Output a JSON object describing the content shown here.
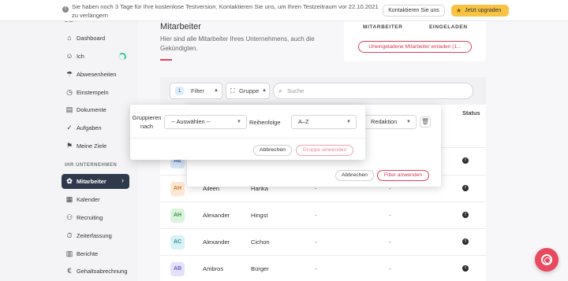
{
  "banner": {
    "text": "Sie haben noch 3 Tage für Ihre kostenlose Testversion. Kontaktieren Sie uns, um Ihren Testzeitraum vor 22.10.2021 zu verlängern",
    "contact_label": "Kontaktieren Sie uns",
    "upgrade_label": "Jetzt upgraden",
    "upgrade_color": "#f6c343"
  },
  "sidebar": {
    "section_top": "SIE",
    "section_company": "IHR UNTERNEHMEN",
    "items_top": [
      {
        "label": "Dashboard",
        "icon": "dashboard-icon"
      },
      {
        "label": "Ich",
        "icon": "user-icon"
      },
      {
        "label": "Abwesenheiten",
        "icon": "absence-icon"
      },
      {
        "label": "Einstempeln",
        "icon": "clock-icon"
      },
      {
        "label": "Dokumente",
        "icon": "document-icon"
      },
      {
        "label": "Aufgaben",
        "icon": "tasks-icon"
      },
      {
        "label": "Meine Ziele",
        "icon": "goals-icon"
      }
    ],
    "items_company": [
      {
        "label": "Mitarbeiter",
        "icon": "employees-icon",
        "active": true
      },
      {
        "label": "Kalender",
        "icon": "calendar-icon"
      },
      {
        "label": "Recruiting",
        "icon": "recruiting-icon"
      },
      {
        "label": "Zeiterfassung",
        "icon": "time-tracking-icon"
      },
      {
        "label": "Berichte",
        "icon": "reports-icon"
      },
      {
        "label": "Gehaltsabrechnung",
        "icon": "payroll-icon"
      }
    ],
    "active_color": "#2e3a4b"
  },
  "main": {
    "title": "Mitarbeiter",
    "subtitle": "Hier sind alle Mitarbeiter Ihres Unternehmens, auch die Gekündigten.",
    "stats": {
      "label_employees": "MITARBEITER",
      "label_invited": "EINGELADEN"
    },
    "invite_button": "Uneingeladene Mitarbeiter einladen (1...",
    "accent_color": "#e0425a"
  },
  "toolbar": {
    "filter_count": "1",
    "filter_label": "Filter",
    "group_label": "Gruppe",
    "search_placeholder": "Suche"
  },
  "table": {
    "status_header": "Status",
    "rows": [
      {
        "initials": "AE",
        "first": "",
        "last": "",
        "c1": "",
        "c2": "",
        "bg": "#dbe8fb",
        "fg": "#4a74b8"
      },
      {
        "initials": "AH",
        "first": "Aileen",
        "last": "Hanka",
        "c1": "-",
        "c2": "-",
        "bg": "#fde7d4",
        "fg": "#d07a2c"
      },
      {
        "initials": "AH",
        "first": "Alexander",
        "last": "Hingst",
        "c1": "-",
        "c2": "-",
        "bg": "#dbf3dc",
        "fg": "#3b9a45"
      },
      {
        "initials": "AC",
        "first": "Alexander",
        "last": "Cichon",
        "c1": "-",
        "c2": "-",
        "bg": "#d8f1f4",
        "fg": "#2e95a3"
      },
      {
        "initials": "AB",
        "first": "Ambros",
        "last": "Bürger",
        "c1": "-",
        "c2": "-",
        "bg": "#e4e2fa",
        "fg": "#6b62c7"
      }
    ]
  },
  "filter_panel": {
    "field_value": "Redaktion",
    "cancel_label": "Abbrechen",
    "apply_label": "Filter anwenden"
  },
  "group_popover": {
    "group_by_label": "Gruppieren nach",
    "group_select_value": "-- Auswählen --",
    "order_label": "Reihenfolge",
    "order_value": "A–Z",
    "cancel_label": "Abbrechen",
    "apply_label": "Gruppe anwenden"
  }
}
